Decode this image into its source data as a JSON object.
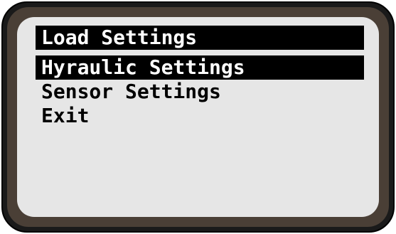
{
  "menu": {
    "items": [
      {
        "label": "Load Settings",
        "selected": true
      },
      {
        "label": "Hyraulic Settings",
        "selected": true
      },
      {
        "label": "Sensor Settings",
        "selected": false
      },
      {
        "label": "Exit",
        "selected": false
      }
    ]
  },
  "colors": {
    "bezel": "#1a1a1a",
    "bezel_inner": "#4a3f36",
    "screen": "#e6e6e6",
    "highlight_bg": "#000000",
    "highlight_text": "#ffffff",
    "text": "#000000"
  }
}
